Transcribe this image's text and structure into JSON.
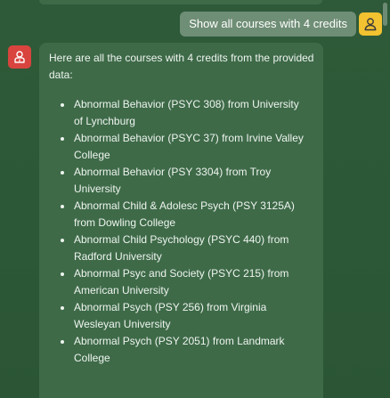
{
  "user_message": {
    "text": "Show all courses with 4 credits"
  },
  "assistant_message": {
    "intro": "Here are all the courses with 4 credits from the provided data:",
    "courses": [
      "Abnormal Behavior (PSYC 308) from University of Lynchburg",
      "Abnormal Behavior (PSYC 37) from Irvine Valley College",
      "Abnormal Behavior (PSY 3304) from Troy University",
      "Abnormal Child & Adolesc Psych (PSY 3125A) from Dowling College",
      "Abnormal Child Psychology (PSYC 440) from Radford University",
      "Abnormal Psyc and Society (PSYC 215) from American University",
      "Abnormal Psych (PSY 256) from Virginia Wesleyan University",
      "Abnormal Psych (PSY 2051) from Landmark College"
    ]
  },
  "icons": {
    "user_avatar": "user-icon",
    "assistant_avatar": "bot-icon"
  },
  "colors": {
    "background": "#2e5a39",
    "assistant_bubble": "#3e6a48",
    "user_bubble": "#6f8e76",
    "user_avatar": "#f2c230",
    "assistant_avatar": "#d9443e"
  }
}
